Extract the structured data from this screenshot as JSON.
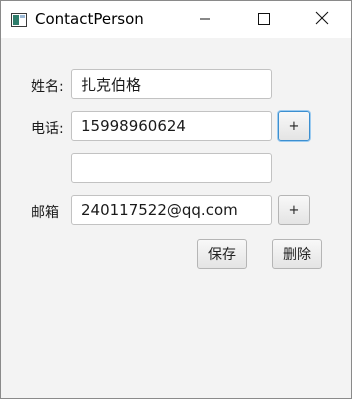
{
  "window": {
    "title": "ContactPerson",
    "controls": {
      "minimize_icon": "minimize-icon",
      "maximize_icon": "maximize-icon",
      "close_icon": "close-icon"
    }
  },
  "form": {
    "name": {
      "label": "姓名:",
      "value": "扎克伯格"
    },
    "phone": {
      "label": "电话:",
      "values": [
        "15998960624",
        ""
      ],
      "add_label": "+"
    },
    "email": {
      "label": "邮箱",
      "value": "240117522@qq.com",
      "add_label": "+"
    }
  },
  "actions": {
    "save_label": "保存",
    "delete_label": "删除"
  },
  "colors": {
    "focus_accent": "#3c8fd0",
    "window_background": "#f3f3f3"
  }
}
